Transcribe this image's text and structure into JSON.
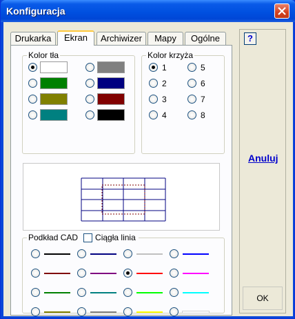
{
  "window": {
    "title": "Konfiguracja"
  },
  "tabs": [
    {
      "label": "Drukarka",
      "active": false
    },
    {
      "label": "Ekran",
      "active": true
    },
    {
      "label": "Archiwizer",
      "active": false
    },
    {
      "label": "Mapy",
      "active": false
    },
    {
      "label": "Ogólne",
      "active": false
    }
  ],
  "background_color": {
    "label": "Kolor tła",
    "swatches": [
      {
        "color": "#FFFFFF",
        "checked": true
      },
      {
        "color": "#008000",
        "checked": false
      },
      {
        "color": "#808000",
        "checked": false
      },
      {
        "color": "#008080",
        "checked": false
      },
      {
        "color": "#808080",
        "checked": false
      },
      {
        "color": "#000080",
        "checked": false
      },
      {
        "color": "#800000",
        "checked": false
      },
      {
        "color": "#000000",
        "checked": false
      }
    ]
  },
  "cross_color": {
    "label": "Kolor krzyża",
    "options": [
      {
        "label": "1",
        "checked": true
      },
      {
        "label": "2",
        "checked": false
      },
      {
        "label": "3",
        "checked": false
      },
      {
        "label": "4",
        "checked": false
      },
      {
        "label": "5",
        "checked": false
      },
      {
        "label": "6",
        "checked": false
      },
      {
        "label": "7",
        "checked": false
      },
      {
        "label": "8",
        "checked": false
      }
    ]
  },
  "preview": {
    "grid_color": "#000080",
    "cross_color": "#800000"
  },
  "cad_background": {
    "label": "Podkład CAD",
    "solid_line_label": "Ciągła linia",
    "solid_line_checked": false,
    "lines": [
      {
        "color": "#000000",
        "checked": false
      },
      {
        "color": "#000080",
        "checked": false
      },
      {
        "color": "#C0C0C0",
        "checked": false
      },
      {
        "color": "#0000FF",
        "checked": false
      },
      {
        "color": "#800000",
        "checked": false
      },
      {
        "color": "#800080",
        "checked": false
      },
      {
        "color": "#FF0000",
        "checked": true
      },
      {
        "color": "#FF00FF",
        "checked": false
      },
      {
        "color": "#008000",
        "checked": false
      },
      {
        "color": "#008080",
        "checked": false
      },
      {
        "color": "#00FF00",
        "checked": false
      },
      {
        "color": "#00FFFF",
        "checked": false
      },
      {
        "color": "#808000",
        "checked": false
      },
      {
        "color": "#808080",
        "checked": false
      },
      {
        "color": "#FFFF00",
        "checked": false
      },
      {
        "color": "#FFFFFF",
        "checked": false
      }
    ]
  },
  "buttons": {
    "help": "?",
    "cancel": "Anuluj",
    "ok": "OK"
  },
  "icons": {
    "close": "close-icon",
    "help": "help-icon"
  }
}
